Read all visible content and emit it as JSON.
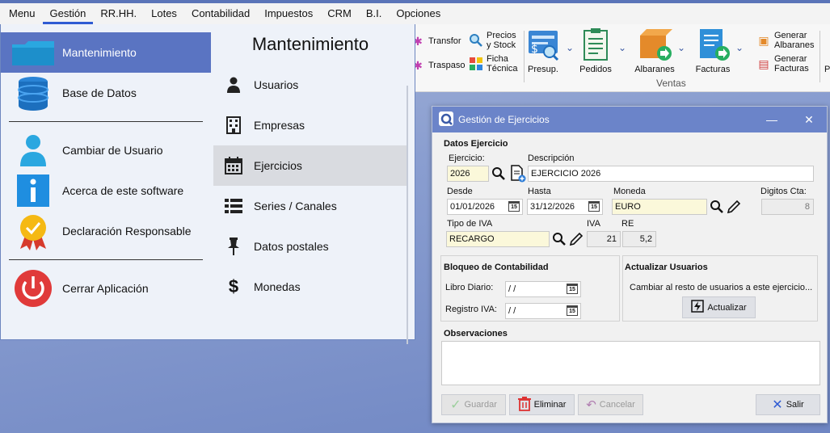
{
  "menubar": {
    "items": [
      "Menu",
      "Gestión",
      "RR.HH.",
      "Lotes",
      "Contabilidad",
      "Impuestos",
      "CRM",
      "B.I.",
      "Opciones"
    ]
  },
  "ribbon": {
    "transfor": "Transfor",
    "traspaso": "Traspaso",
    "precios": "Precios y Stock",
    "ficha": "Ficha Técnica",
    "presup": "Presup.",
    "pedidos": "Pedidos",
    "albaranes": "Albaranes",
    "facturas": "Facturas",
    "generar_albaranes": "Generar Albaranes",
    "generar_facturas": "Generar Facturas",
    "group_label": "Ventas",
    "cut_label": "P"
  },
  "menu_panel": {
    "left_items": [
      {
        "label": "Mantenimiento",
        "icon": "folder-icon",
        "selected": true
      },
      {
        "label": "Base de Datos",
        "icon": "database-icon"
      },
      {
        "label": "Cambiar de Usuario",
        "icon": "user-icon"
      },
      {
        "label": "Acerca de este software",
        "icon": "info-icon"
      },
      {
        "label": "Declaración Responsable",
        "icon": "medal-icon"
      },
      {
        "label": "Cerrar Aplicación",
        "icon": "power-icon"
      }
    ],
    "right_title": "Mantenimiento",
    "right_items": [
      {
        "label": "Usuarios",
        "icon": "user-icon"
      },
      {
        "label": "Empresas",
        "icon": "building-icon"
      },
      {
        "label": "Ejercicios",
        "icon": "calendar-icon",
        "selected": true
      },
      {
        "label": "Series / Canales",
        "icon": "list-icon"
      },
      {
        "label": "Datos postales",
        "icon": "pin-icon"
      },
      {
        "label": "Monedas",
        "icon": "dollar-icon"
      }
    ]
  },
  "dialog": {
    "title": "Gestión de Ejercicios",
    "datos_header": "Datos Ejercicio",
    "ejercicio_label": "Ejercicio:",
    "ejercicio_value": "2026",
    "descripcion_label": "Descripción",
    "descripcion_value": "EJERCICIO 2026",
    "desde_label": "Desde",
    "desde_value": "01/01/2026",
    "hasta_label": "Hasta",
    "hasta_value": "31/12/2026",
    "moneda_label": "Moneda",
    "moneda_value": "EURO",
    "digitos_label": "Digitos Cta:",
    "digitos_value": "8",
    "tipo_iva_label": "Tipo de IVA",
    "tipo_iva_value": "RECARGO",
    "iva_label": "IVA",
    "iva_value": "21",
    "re_label": "RE",
    "re_value": "5,2",
    "bloqueo_header": "Bloqueo de Contabilidad",
    "libro_label": "Libro Diario:",
    "libro_value": " / /",
    "registro_label": "Registro IVA:",
    "registro_value": " / /",
    "actualizar_header": "Actualizar Usuarios",
    "actualizar_text": "Cambiar al resto de usuarios a este ejercicio...",
    "actualizar_button": "Actualizar",
    "observaciones_header": "Observaciones",
    "observaciones_value": "",
    "guardar": "Guardar",
    "eliminar": "Eliminar",
    "cancelar": "Cancelar",
    "salir": "Salir",
    "cal_badge": "15"
  },
  "colors": {
    "selected_menu": "#5a74c2",
    "title_bar": "#6b84c9",
    "accent": "#2f5bd3"
  }
}
